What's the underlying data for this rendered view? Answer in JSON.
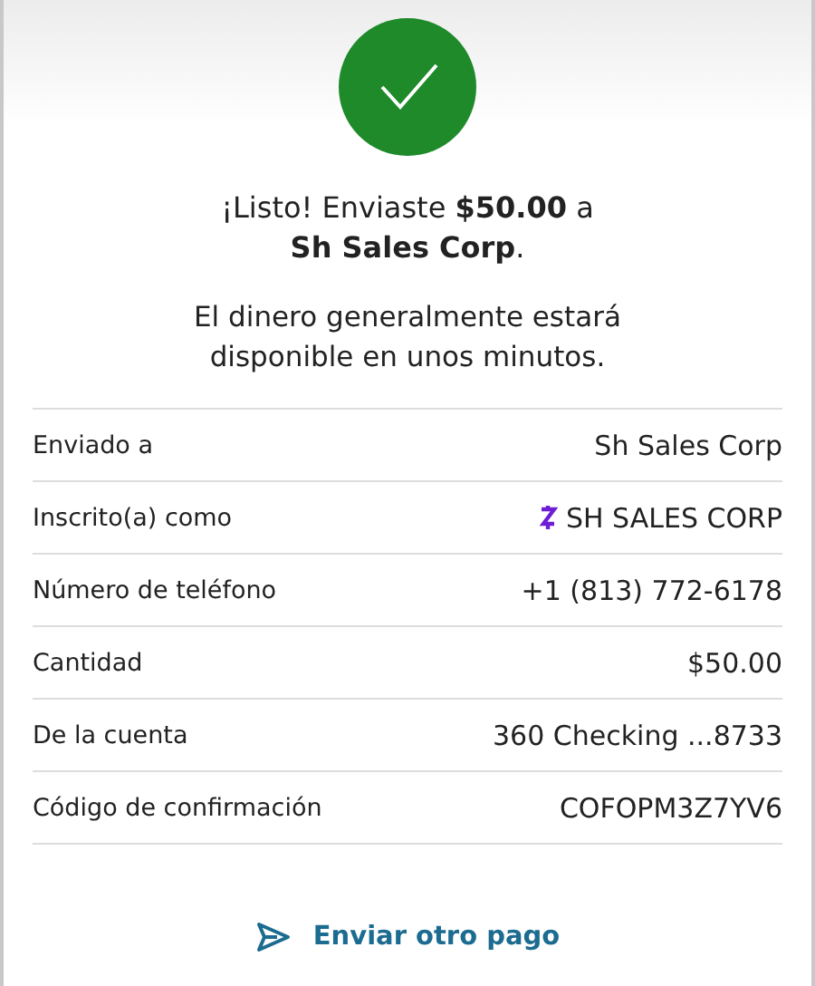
{
  "headline": "¡Listo! Enviaste **$50.00** a **Sh Sales Corp**.",
  "note": "El dinero generalmente estará disponible en unos minutos.",
  "details": [
    {
      "kind": "plain",
      "label": "Enviado a",
      "value": "Sh Sales Corp"
    },
    {
      "kind": "zelle",
      "label": "Inscrito(a) como",
      "value": "SH SALES CORP"
    },
    {
      "kind": "plain",
      "label": "Número de teléfono",
      "value": "+1 (813) 772-6178"
    },
    {
      "kind": "plain",
      "label": "Cantidad",
      "value": "$50.00"
    },
    {
      "kind": "plain",
      "label": "De la cuenta",
      "value": "360 Checking ...8733"
    },
    {
      "kind": "plain",
      "label": "Código de confirmación",
      "value": "COFOPM3Z7YV6"
    }
  ],
  "action": {
    "label": "Enviar otro pago"
  }
}
